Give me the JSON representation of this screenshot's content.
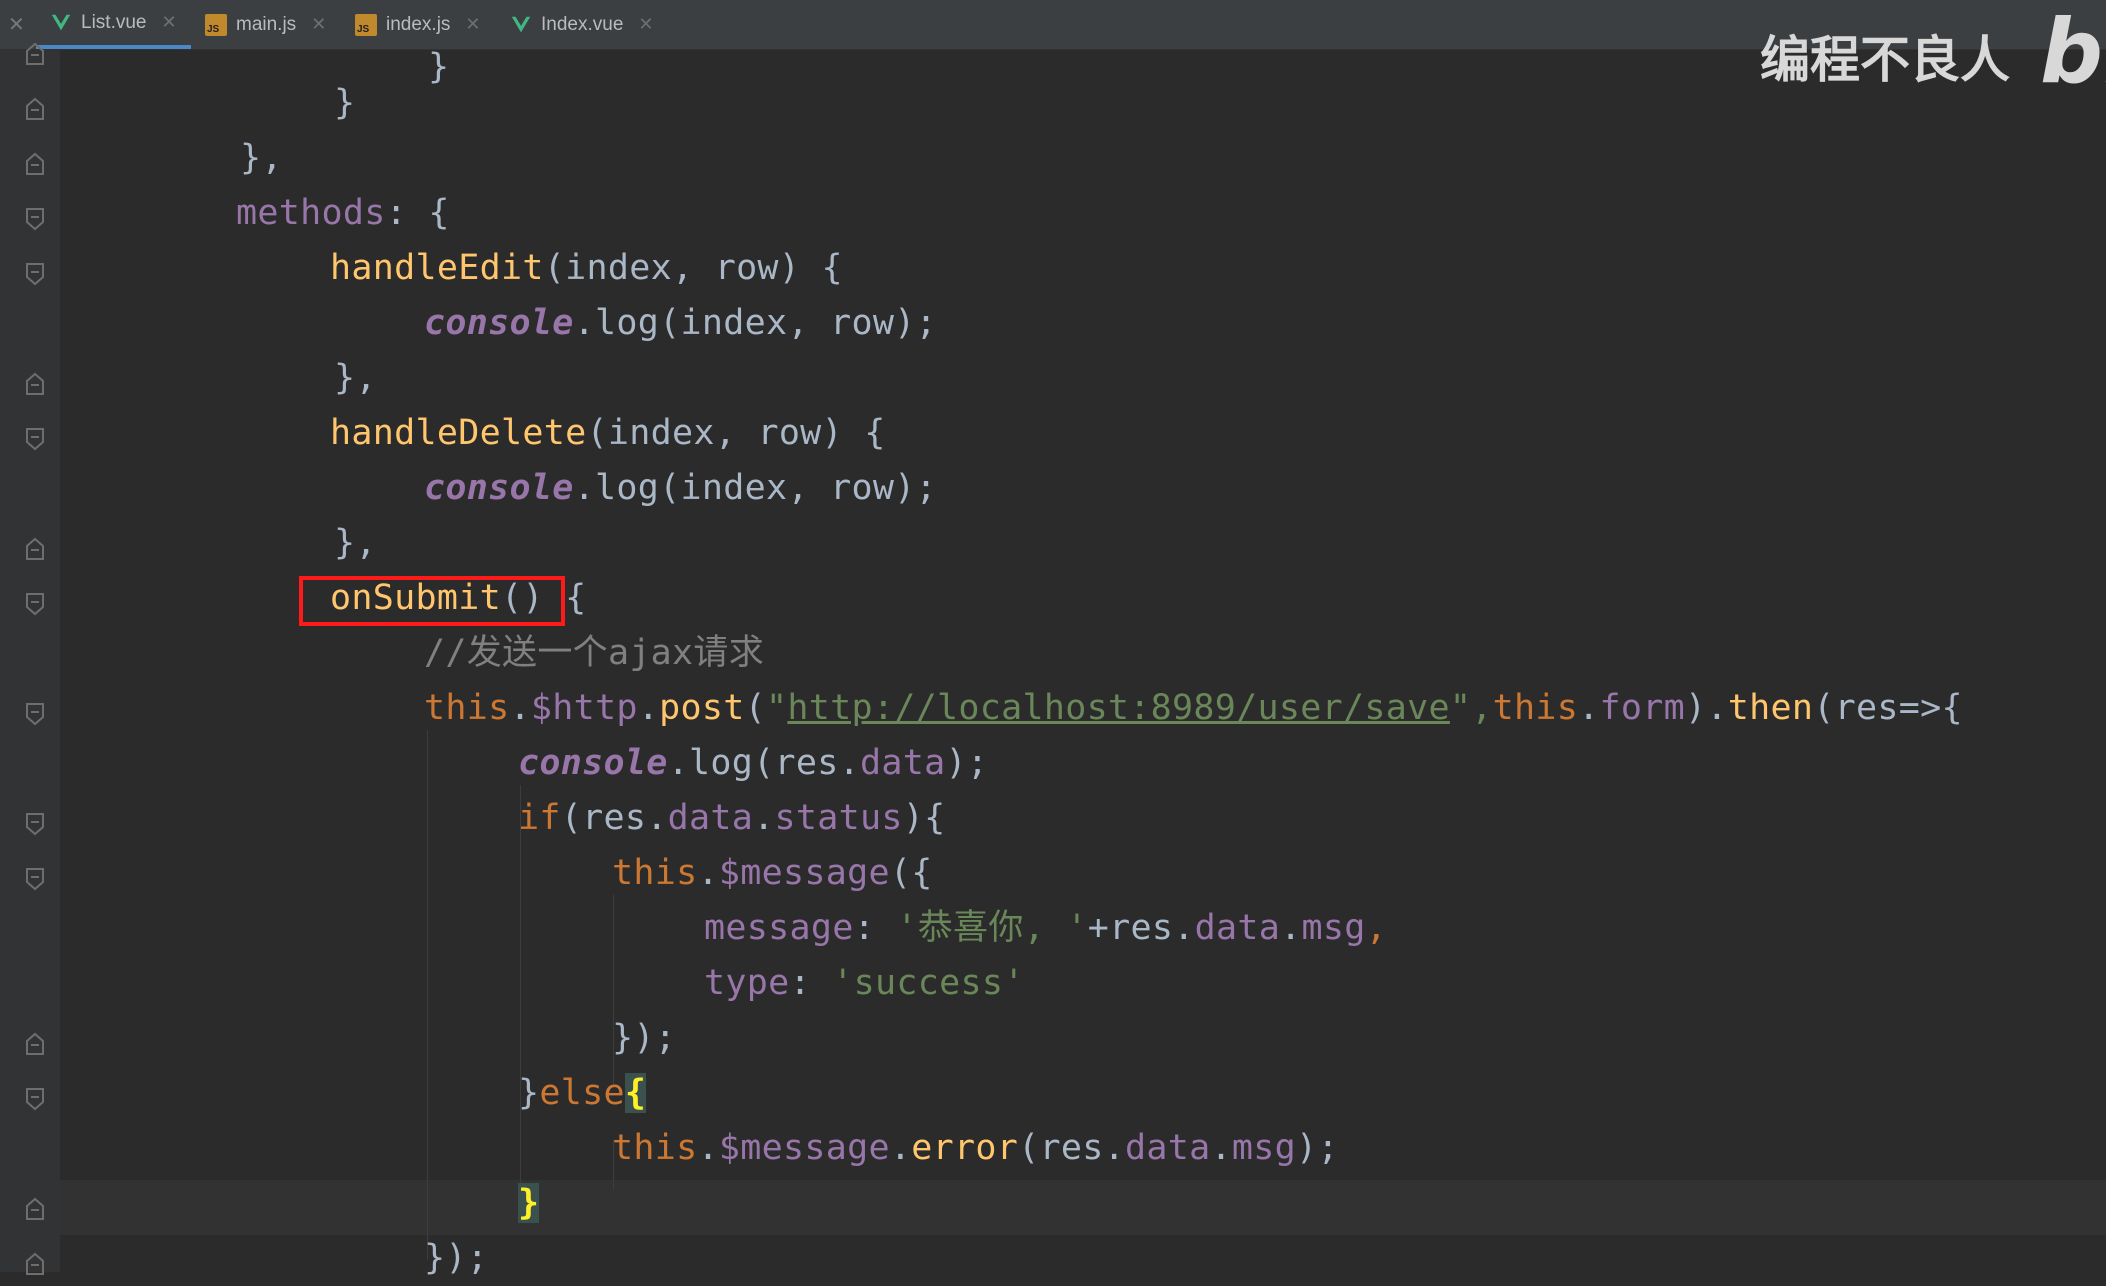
{
  "tabs": [
    {
      "label": "List.vue",
      "icon": "vue-icon",
      "active": true
    },
    {
      "label": "main.js",
      "icon": "js-file-icon",
      "active": false
    },
    {
      "label": "index.js",
      "icon": "js-file-icon",
      "active": false
    },
    {
      "label": "Index.vue",
      "icon": "vue-icon",
      "active": false
    }
  ],
  "watermark": {
    "text": "编程不良人",
    "logo": "bi"
  },
  "code": {
    "l0": "}",
    "l1": "}",
    "l2a": "},",
    "l3_methods": "methods",
    "l3_rest": ": {",
    "l4_fn": "handleEdit",
    "l4_rest": "(index, row) {",
    "l5_obj": "console",
    "l5_rest": ".log(index, row);",
    "l6": "},",
    "l7_fn": "handleDelete",
    "l7_rest": "(index, row) {",
    "l8_obj": "console",
    "l8_rest": ".log(index, row);",
    "l9": "},",
    "l10_fn": "onSubmit",
    "l10_paren": "()",
    "l10_brace": "{",
    "l11_comment": "//发送一个ajax请求",
    "l12_this": "this",
    "l12_http": "$http",
    "l12_post": "post",
    "l12_q": "\"",
    "l12_url": "http://localhost:8989/user/save",
    "l12_comma": "\",",
    "l12_this2": "this",
    "l12_form": "form",
    "l12_then": "then",
    "l12_rest": "(res=>{",
    "l13_obj": "console",
    "l13_log": ".log(res.",
    "l13_data": "data",
    "l13_end": ");",
    "l14_if": "if",
    "l14_a": "(res.",
    "l14_data": "data",
    "l14_status": "status",
    "l14_end": "){",
    "l15_this": "this",
    "l15_msg": "$message",
    "l15_end": "({",
    "l16_key": "message",
    "l16_str": "'恭喜你, '",
    "l16_plus": "+res.",
    "l16_data": "data",
    "l16_msg": "msg",
    "l17_key": "type",
    "l17_str": "'success'",
    "l18": "});",
    "l19_close": "}",
    "l19_else": "else",
    "l19_brace": "{",
    "l20_this": "this",
    "l20_msg": "$message",
    "l20_err": "error",
    "l20_a": "(res.",
    "l20_data": "data",
    "l20_msgf": "msg",
    "l20_end": ");",
    "l21": "}",
    "l22": "});"
  }
}
